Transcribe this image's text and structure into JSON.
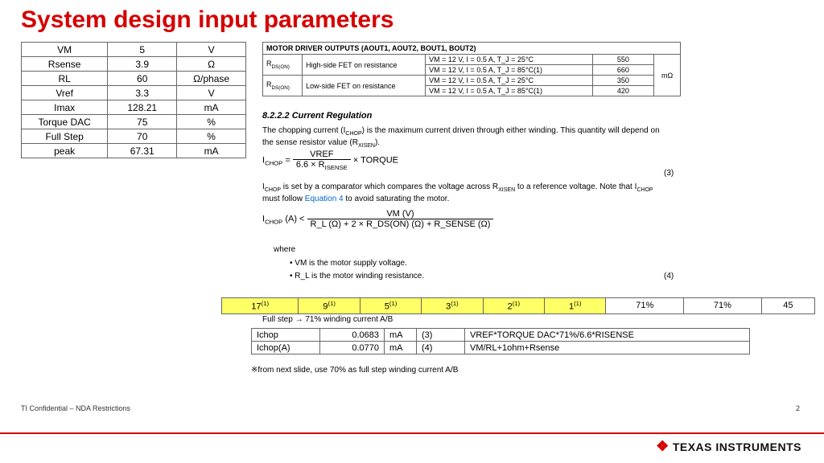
{
  "title": "System design input parameters",
  "input_params": [
    {
      "name": "VM",
      "val": "5",
      "unit": "V"
    },
    {
      "name": "Rsense",
      "val": "3.9",
      "unit": "Ω"
    },
    {
      "name": "RL",
      "val": "60",
      "unit": "Ω/phase"
    },
    {
      "name": "Vref",
      "val": "3.3",
      "unit": "V"
    },
    {
      "name": "Imax",
      "val": "128.21",
      "unit": "mA"
    },
    {
      "name": "Torque DAC",
      "val": "75",
      "unit": "%"
    },
    {
      "name": "Full Step",
      "val": "70",
      "unit": "%"
    },
    {
      "name": "peak",
      "val": "67.31",
      "unit": "mA"
    }
  ],
  "rds_header": "MOTOR DRIVER OUTPUTS (AOUT1, AOUT2, BOUT1, BOUT2)",
  "rds": [
    {
      "sym": "R",
      "sub": "DS(ON)",
      "desc": "High-side FET on resistance",
      "cond": "VM = 12 V, I = 0.5 A, T_J = 25°C",
      "typ": "550"
    },
    {
      "sym": "",
      "sub": "",
      "desc": "",
      "cond": "VM = 12 V, I = 0.5 A, T_J = 85°C(1)",
      "typ": "660"
    },
    {
      "sym": "R",
      "sub": "DS(ON)",
      "desc": "Low-side FET on resistance",
      "cond": "VM = 12 V, I = 0.5 A, T_J = 25°C",
      "typ": "350"
    },
    {
      "sym": "",
      "sub": "",
      "desc": "",
      "cond": "VM = 12 V, I = 0.5 A, T_J = 85°C(1)",
      "typ": "420"
    }
  ],
  "rds_unit": "mΩ",
  "section": "8.2.2.2   Current Regulation",
  "p1a": "The chopping current (I",
  "p1b": ") is the maximum current driven through either winding. This quantity will depend on the sense resistor value (R",
  "p1c": ").",
  "sub_chop": "CHOP",
  "sub_xisen": "XISEN",
  "eq3_lhs": "I",
  "eq3_sub": "CHOP",
  "eq3_equals": " = ",
  "eq3_top": "VREF",
  "eq3_bot_a": "6.6 × R",
  "eq3_bot_sub": "ISENSE",
  "eq3_mult": " × TORQUE",
  "eq3_num": "(3)",
  "p2a": "I",
  "p2b": " is set by a comparator which compares the voltage across R",
  "p2c": " to a reference voltage. Note that I",
  "p2d": " must follow ",
  "p2link": "Equation 4",
  "p2e": " to avoid saturating the motor.",
  "eq4_lhs": "I",
  "eq4_sub": "CHOP",
  "eq4_arg": " (A)  <  ",
  "eq4_top": "VM (V)",
  "eq4_bot": "R_L (Ω) + 2 × R_DS(ON) (Ω) + R_SENSE (Ω)",
  "where": "where",
  "b1": "•   VM is the motor supply voltage.",
  "b2": "•   R_L is the motor winding resistance.",
  "eq4_num": "(4)",
  "steps": [
    "17",
    "9",
    "5",
    "3",
    "2",
    "1"
  ],
  "step_sup": "(1)",
  "step_r1": "71%",
  "step_r2": "71%",
  "step_r3": "45",
  "fullstep_note": "Full step → 71% winding current A/B",
  "ichop": [
    {
      "n": "Ichop",
      "v": "0.0683",
      "u": "mA",
      "eq": "(3)",
      "f": "VREF*TORQUE DAC*71%/6.6*RISENSE"
    },
    {
      "n": "Ichop(A)",
      "v": "0.0770",
      "u": "mA",
      "eq": "(4)",
      "f": "VM/RL+1ohm+Rsense"
    }
  ],
  "footnote2": "※from next slide, use 70% as full step winding current A/B",
  "confidential": "TI Confidential – NDA Restrictions",
  "page": "2",
  "logo": "TEXAS INSTRUMENTS"
}
